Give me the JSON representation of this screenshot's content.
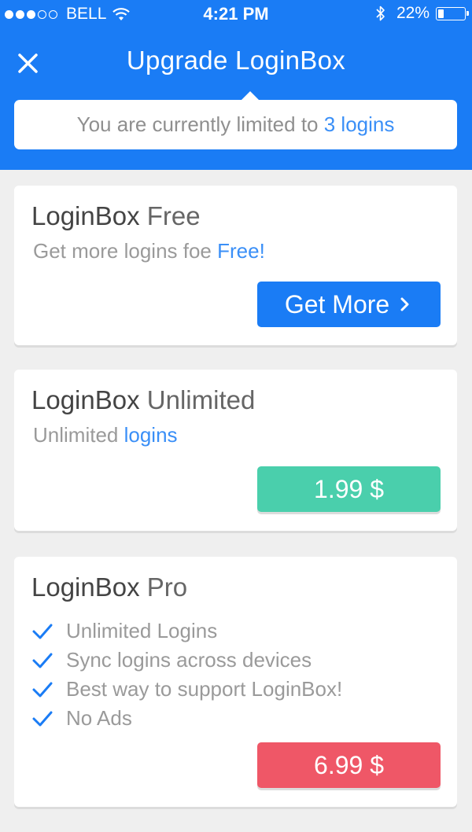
{
  "status_bar": {
    "carrier": "BELL",
    "time": "4:21 PM",
    "battery_percent": "22%",
    "battery_level": 0.22,
    "signal_dots_filled": 3,
    "signal_dots_total": 5
  },
  "nav": {
    "close_icon": "close-icon",
    "title": "Upgrade LoginBox"
  },
  "notice": {
    "prefix": "You are currently limited to ",
    "highlight": "3 logins"
  },
  "plans": [
    {
      "title_bold": "LoginBox",
      "title_light": " Free",
      "subtitle_prefix": "Get more logins foe ",
      "subtitle_highlight": "Free!",
      "button_label": "Get More",
      "button_icon": "chevron-right-icon"
    },
    {
      "title_bold": "LoginBox",
      "title_light": " Unlimited",
      "subtitle_prefix": "Unlimited ",
      "subtitle_highlight": "logins",
      "button_label": "1.99 $"
    },
    {
      "title_bold": "LoginBox",
      "title_light": " Pro",
      "features": [
        "Unlimited Logins",
        "Sync logins across devices",
        "Best way to support LoginBox!",
        "No Ads"
      ],
      "button_label": "6.99 $"
    }
  ],
  "colors": {
    "primary_blue": "#1a7cf5",
    "link_blue": "#3a8ff7",
    "green": "#4acfac",
    "red": "#ef5767"
  }
}
